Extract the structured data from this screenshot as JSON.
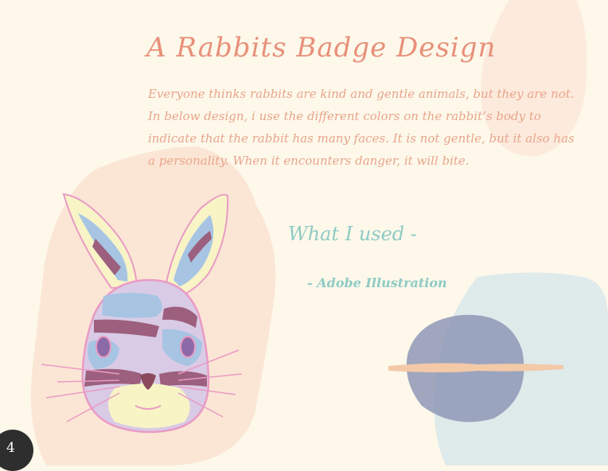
{
  "title": "A Rabbits Badge Design",
  "description": "Everyone thinks rabbits are kind and gentle animals, but they are not. In below design, i use the different colors on the rabbit’s body to indicate that the rabbit has many faces. It is not gentle, but it also has a personality. When it encounters danger, it will bite.",
  "tools": {
    "heading": "What I used -",
    "items": [
      "- Adobe Illustration"
    ]
  },
  "page_number": "4",
  "colors": {
    "background": "#fdf8ea",
    "title": "#e8907a",
    "body": "#e9a58c",
    "accent_teal": "#8fcbc4",
    "peach_blob": "#fbe3d3",
    "blue_blob": "#dbe7ea"
  }
}
